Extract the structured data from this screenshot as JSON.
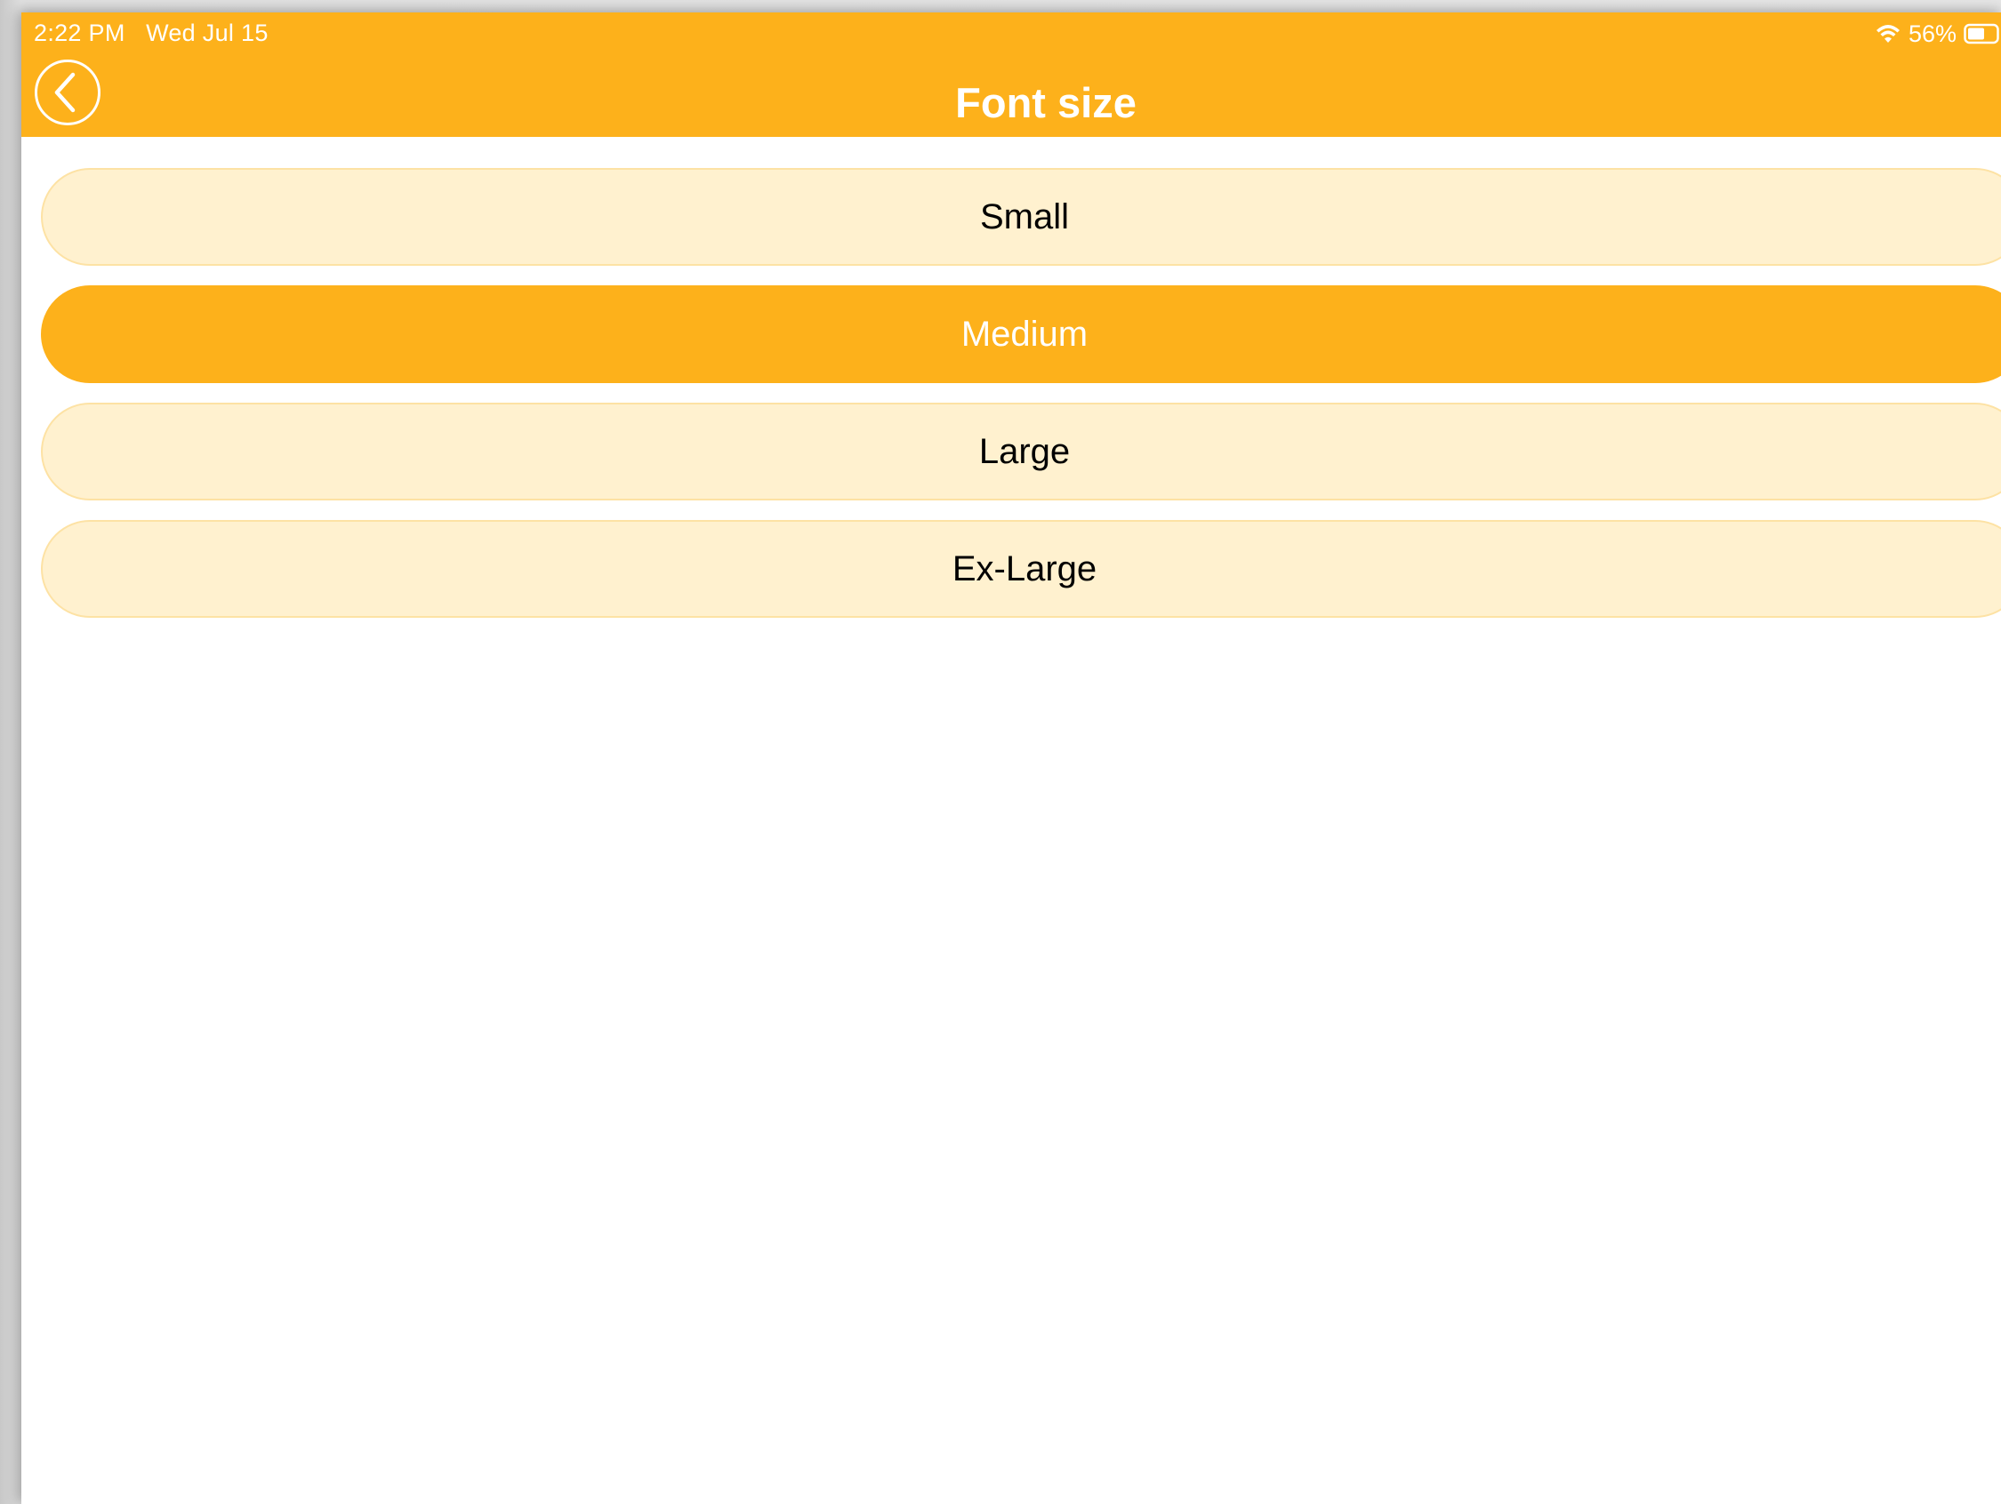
{
  "colors": {
    "accent": "#fdb11b",
    "option_bg": "#fff1cf",
    "option_border": "#fde2a4",
    "text_dark": "#000000",
    "text_light": "#ffffff"
  },
  "status_bar": {
    "time": "2:22 PM",
    "date": "Wed Jul 15",
    "battery_percent": "56%",
    "wifi_icon": "wifi-icon",
    "battery_icon": "battery-icon"
  },
  "header": {
    "title": "Font size",
    "back_icon": "chevron-left-circle-icon"
  },
  "font_options": [
    {
      "label": "Small",
      "selected": false
    },
    {
      "label": "Medium",
      "selected": true
    },
    {
      "label": "Large",
      "selected": false
    },
    {
      "label": "Ex-Large",
      "selected": false
    }
  ]
}
